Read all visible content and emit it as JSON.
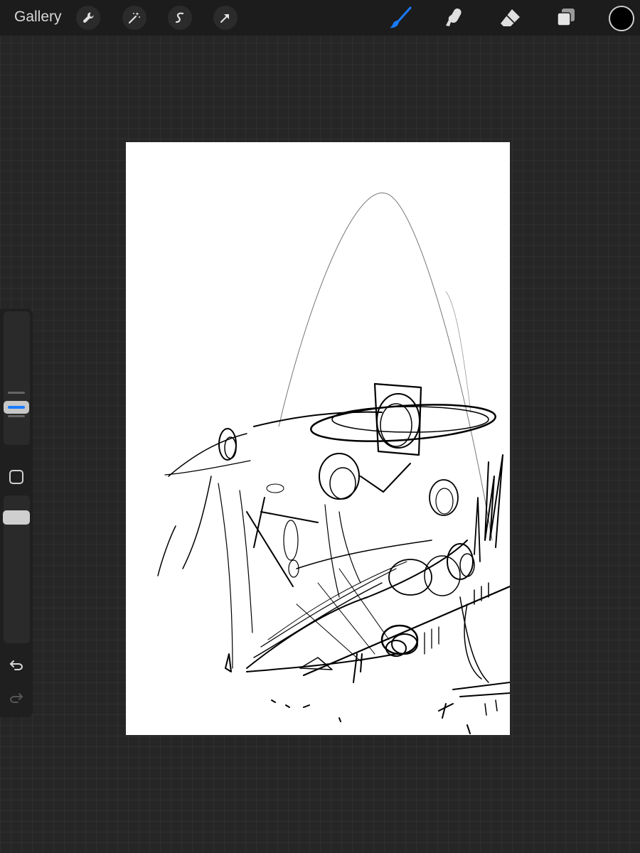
{
  "topbar": {
    "gallery_label": "Gallery",
    "actions": [
      {
        "name": "actions-wrench",
        "icon": "wrench-icon"
      },
      {
        "name": "adjustments",
        "icon": "magic-wand-icon"
      },
      {
        "name": "selection",
        "icon": "selection-s-icon"
      },
      {
        "name": "transform",
        "icon": "arrow-cursor-icon"
      }
    ],
    "tools": [
      {
        "name": "brush",
        "icon": "brush-icon",
        "active": true
      },
      {
        "name": "smudge",
        "icon": "smudge-finger-icon",
        "active": false
      },
      {
        "name": "eraser",
        "icon": "eraser-icon",
        "active": false
      },
      {
        "name": "layers",
        "icon": "layers-icon",
        "active": false
      }
    ],
    "current_color": "#000000"
  },
  "colors": {
    "accent": "#1a7bff",
    "workspace": "#262626",
    "toolbar": "#1c1c1c",
    "canvas": "#ffffff"
  },
  "sidebar": {
    "brush_size_slider": {
      "icon": "brush-size-handle"
    },
    "modify_button": {
      "icon": "square-modify-icon"
    },
    "opacity_slider": {
      "icon": "opacity-handle"
    },
    "undo": {
      "icon": "undo-arrow-icon"
    },
    "redo": {
      "icon": "redo-arrow-icon",
      "enabled": false
    }
  },
  "canvas": {
    "content": "sketch"
  }
}
